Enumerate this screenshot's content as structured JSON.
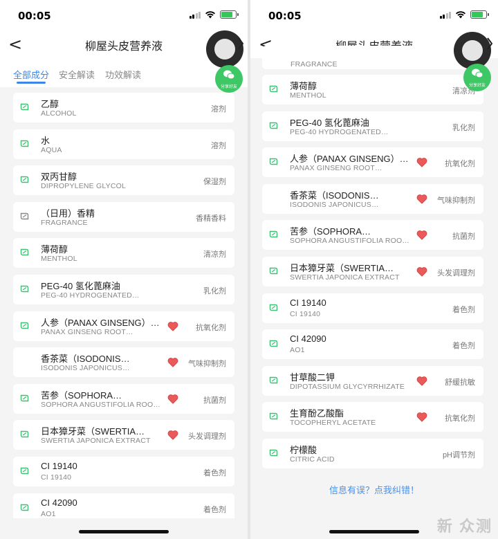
{
  "status": {
    "time": "00:05"
  },
  "nav": {
    "title": "柳屋头皮营养液",
    "back": "<"
  },
  "tabs": [
    "全部成分",
    "安全解读",
    "功效解读"
  ],
  "share_label": "分享好友",
  "colors": {
    "accent": "#3d86e8",
    "leaf": "#3cbf73",
    "heart": "#ea5a5a",
    "share": "#3dc765"
  },
  "left_items": [
    {
      "name": "乙醇",
      "sub": "ALCOHOL",
      "fn": "溶剂",
      "heart": false,
      "icon": "leaf-icon"
    },
    {
      "name": "水",
      "sub": "AQUA",
      "fn": "溶剂",
      "heart": false,
      "icon": "leaf-icon"
    },
    {
      "name": "双丙甘醇",
      "sub": "DIPROPYLENE GLYCOL",
      "fn": "保湿剂",
      "heart": false,
      "icon": "leaf-icon"
    },
    {
      "name": "（日用）香精",
      "sub": "FRAGRANCE",
      "fn": "香精香料",
      "heart": false,
      "icon": "gray-leaf-icon"
    },
    {
      "name": "薄荷醇",
      "sub": "MENTHOL",
      "fn": "清凉剂",
      "heart": false,
      "icon": "leaf-icon"
    },
    {
      "name": "PEG-40 氢化蓖麻油",
      "sub": "PEG-40 HYDROGENATED…",
      "fn": "乳化剂",
      "heart": false,
      "icon": "leaf-icon"
    },
    {
      "name": "人参（PANAX GINSENG）…",
      "sub": "PANAX GINSENG ROOT…",
      "fn": "抗氧化剂",
      "heart": true,
      "icon": "leaf-icon"
    },
    {
      "name": "香茶菜（ISODONIS…",
      "sub": "ISODONIS JAPONICUS…",
      "fn": "气味抑制剂",
      "heart": true,
      "icon": "none"
    },
    {
      "name": "苦参（SOPHORA…",
      "sub": "SOPHORA ANGUSTIFOLIA ROO…",
      "fn": "抗菌剂",
      "heart": true,
      "icon": "leaf-icon"
    },
    {
      "name": "日本獐牙菜（SWERTIA…",
      "sub": "SWERTIA JAPONICA EXTRACT",
      "fn": "头发调理剂",
      "heart": true,
      "icon": "leaf-icon"
    },
    {
      "name": "CI 19140",
      "sub": "CI 19140",
      "fn": "着色剂",
      "heart": false,
      "icon": "leaf-icon"
    },
    {
      "name": "CI 42090",
      "sub": "AO1",
      "fn": "着色剂",
      "heart": false,
      "icon": "leaf-icon"
    }
  ],
  "right_partial": "FRAGRANCE",
  "right_items": [
    {
      "name": "薄荷醇",
      "sub": "MENTHOL",
      "fn": "清凉剂",
      "heart": false,
      "icon": "leaf-icon"
    },
    {
      "name": "PEG-40 氢化蓖麻油",
      "sub": "PEG-40 HYDROGENATED…",
      "fn": "乳化剂",
      "heart": false,
      "icon": "leaf-icon"
    },
    {
      "name": "人参（PANAX GINSENG）…",
      "sub": "PANAX GINSENG ROOT…",
      "fn": "抗氧化剂",
      "heart": true,
      "icon": "leaf-icon"
    },
    {
      "name": "香茶菜（ISODONIS…",
      "sub": "ISODONIS JAPONICUS…",
      "fn": "气味抑制剂",
      "heart": true,
      "icon": "none"
    },
    {
      "name": "苦参（SOPHORA…",
      "sub": "SOPHORA ANGUSTIFOLIA ROO…",
      "fn": "抗菌剂",
      "heart": true,
      "icon": "leaf-icon"
    },
    {
      "name": "日本獐牙菜（SWERTIA…",
      "sub": "SWERTIA JAPONICA EXTRACT",
      "fn": "头发调理剂",
      "heart": true,
      "icon": "leaf-icon"
    },
    {
      "name": "CI 19140",
      "sub": "CI 19140",
      "fn": "着色剂",
      "heart": false,
      "icon": "leaf-icon"
    },
    {
      "name": "CI 42090",
      "sub": "AO1",
      "fn": "着色剂",
      "heart": false,
      "icon": "leaf-icon"
    },
    {
      "name": "甘草酸二钾",
      "sub": "DIPOTASSIUM GLYCYRRHIZATE",
      "fn": "舒缓抗敏",
      "heart": true,
      "icon": "leaf-icon"
    },
    {
      "name": "生育酚乙酸酯",
      "sub": "TOCOPHERYL ACETATE",
      "fn": "抗氧化剂",
      "heart": true,
      "icon": "leaf-icon"
    },
    {
      "name": "柠檬酸",
      "sub": "CITRIC ACID",
      "fn": "pH调节剂",
      "heart": false,
      "icon": "leaf-icon"
    }
  ],
  "footer_link": "信息有误？点我纠错！",
  "watermark": "新 众测"
}
